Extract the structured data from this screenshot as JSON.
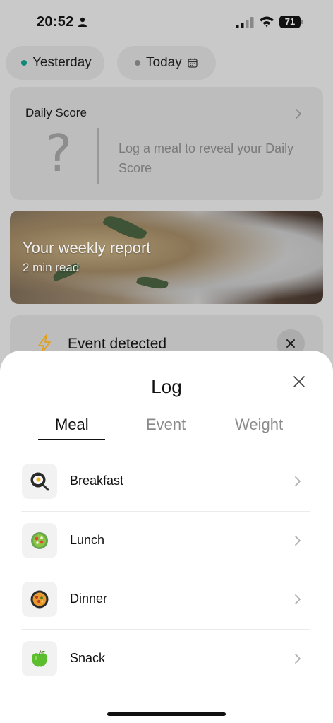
{
  "status_bar": {
    "time": "20:52",
    "battery": "71"
  },
  "day_selector": {
    "yesterday_label": "Yesterday",
    "today_label": "Today"
  },
  "daily_score": {
    "title": "Daily Score",
    "placeholder_symbol": "?",
    "message": "Log a meal to reveal your Daily Score"
  },
  "weekly_report": {
    "title": "Your weekly report",
    "subtitle": "2 min read"
  },
  "event_card": {
    "title": "Event detected"
  },
  "log_sheet": {
    "title": "Log",
    "tabs": [
      {
        "label": "Meal",
        "active": true
      },
      {
        "label": "Event",
        "active": false
      },
      {
        "label": "Weight",
        "active": false
      }
    ],
    "meals": [
      {
        "label": "Breakfast",
        "icon": "fried-egg-pan-icon"
      },
      {
        "label": "Lunch",
        "icon": "salad-bowl-icon"
      },
      {
        "label": "Dinner",
        "icon": "paella-pan-icon"
      },
      {
        "label": "Snack",
        "icon": "green-apple-icon"
      }
    ]
  },
  "colors": {
    "accent_green": "#0f8a78",
    "bolt_orange": "#e0a020",
    "overlay_gray": "#c9c9c9"
  }
}
